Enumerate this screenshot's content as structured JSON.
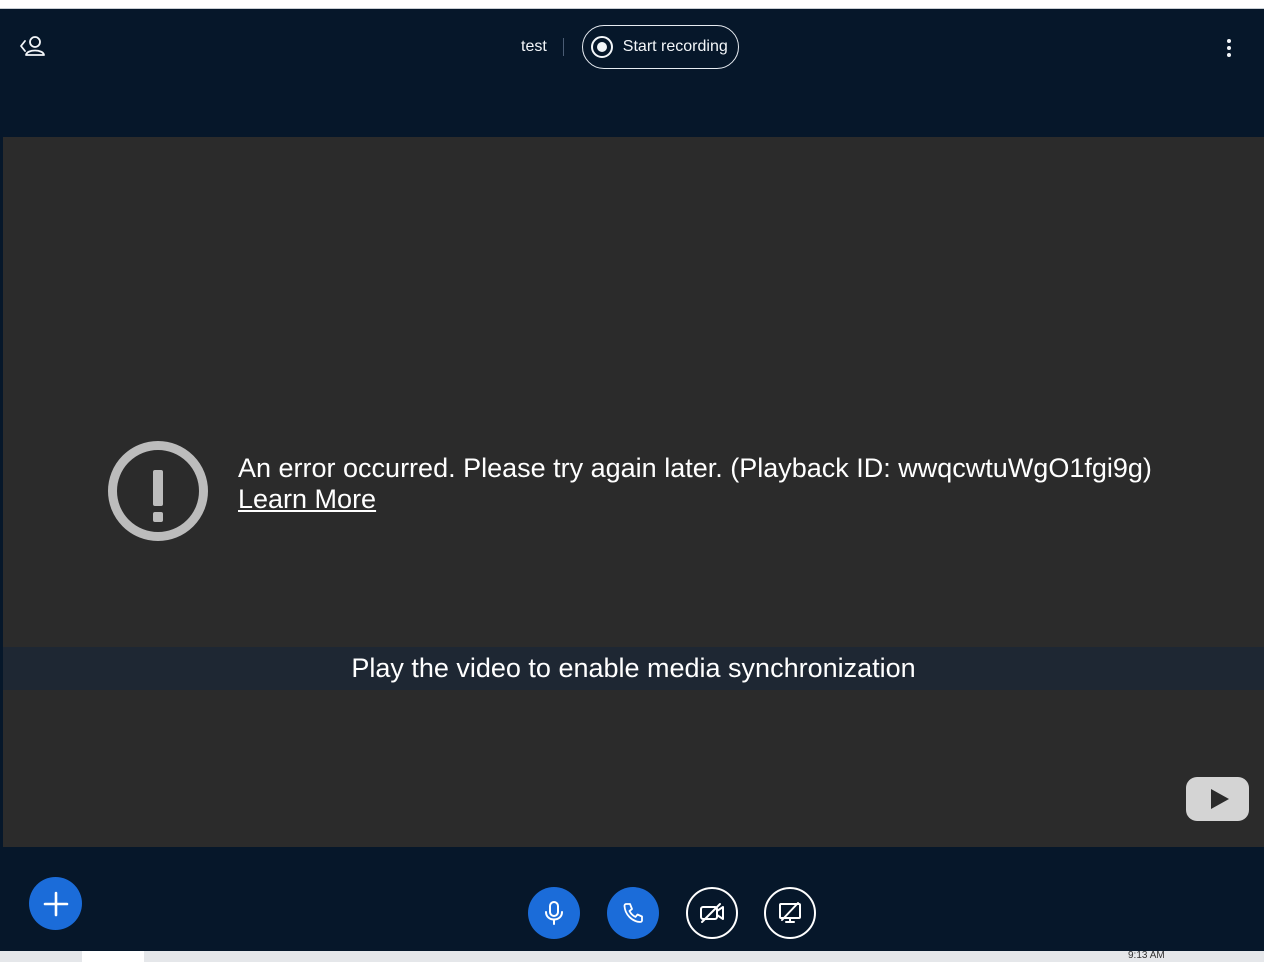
{
  "header": {
    "meeting_title": "test",
    "record_label": "Start recording"
  },
  "video": {
    "error_message": "An error occurred. Please try again later. (Playback ID: wwqcwtuWgO1fgi9g)",
    "learn_more": "Learn More",
    "sync_message": "Play the video to enable media synchronization"
  },
  "icons": {
    "user_list": "user-list-toggle-icon",
    "record": "record-icon",
    "options": "more-vertical-icon",
    "error": "alert-circle-icon",
    "play": "youtube-play-icon",
    "plus": "plus-icon",
    "mic": "microphone-icon",
    "phone": "phone-icon",
    "camera_off": "video-off-icon",
    "screen_share_off": "screen-share-off-icon"
  },
  "taskbar": {
    "clock": "9:13 AM"
  },
  "colors": {
    "app_bg": "#06172a",
    "video_bg": "#2b2b2b",
    "primary_blue": "#1b6cd9"
  }
}
